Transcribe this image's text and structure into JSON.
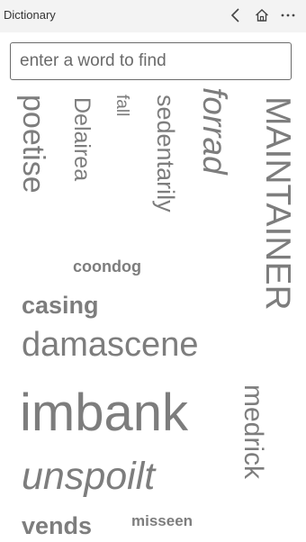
{
  "app": {
    "title": "Dictionary"
  },
  "titlebar": {
    "back_icon": "chevron-left-icon",
    "home_icon": "home-icon",
    "more_icon": "more-icon"
  },
  "search": {
    "placeholder": "enter a word to find",
    "value": ""
  },
  "word_cloud": {
    "words": [
      {
        "text": "poetise"
      },
      {
        "text": "Delairea"
      },
      {
        "text": "fall"
      },
      {
        "text": "sedentarily"
      },
      {
        "text": "forrad"
      },
      {
        "text": "MAINTAINER"
      },
      {
        "text": "coondog"
      },
      {
        "text": "casing"
      },
      {
        "text": "damascene"
      },
      {
        "text": "imbank"
      },
      {
        "text": "medrick"
      },
      {
        "text": "unspoilt"
      },
      {
        "text": "vends"
      },
      {
        "text": "misseen"
      }
    ],
    "text_color": "#7d7d7d"
  }
}
